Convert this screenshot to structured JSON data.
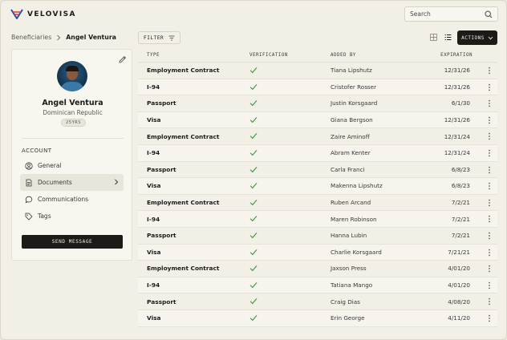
{
  "app": {
    "brand": "VELOVISA"
  },
  "search": {
    "placeholder": "Search"
  },
  "breadcrumb": {
    "root": "Beneficiaries",
    "current": "Angel Ventura"
  },
  "profile": {
    "name": "Angel Ventura",
    "country": "Dominican Republic",
    "age": "25YRS",
    "section_label": "ACCOUNT",
    "nav": [
      {
        "label": "General",
        "icon": "user-circle-icon"
      },
      {
        "label": "Documents",
        "icon": "document-icon",
        "active": true
      },
      {
        "label": "Communications",
        "icon": "chat-bubble-icon"
      },
      {
        "label": "Tags",
        "icon": "tag-icon"
      }
    ],
    "send_label": "SEND MESSAGE"
  },
  "toolbar": {
    "filter_label": "FILTER",
    "actions_label": "ACTIONS"
  },
  "table": {
    "columns": [
      "TYPE",
      "VERIFICATION",
      "ADDED BY",
      "EXPIRATION"
    ],
    "rows": [
      {
        "type": "Employment Contract",
        "verified": true,
        "added_by": "Tiana Lipshutz",
        "expiration": "12/31/26"
      },
      {
        "type": "I-94",
        "verified": true,
        "added_by": "Cristofer Rosser",
        "expiration": "12/31/26"
      },
      {
        "type": "Passport",
        "verified": true,
        "added_by": "Justin Korsgaard",
        "expiration": "6/1/30"
      },
      {
        "type": "Visa",
        "verified": true,
        "added_by": "Giana Bergson",
        "expiration": "12/31/26"
      },
      {
        "type": "Employment Contract",
        "verified": true,
        "added_by": "Zaire Aminoff",
        "expiration": "12/31/24"
      },
      {
        "type": "I-94",
        "verified": true,
        "added_by": "Abram Kenter",
        "expiration": "12/31/24"
      },
      {
        "type": "Passport",
        "verified": true,
        "added_by": "Carla Franci",
        "expiration": "6/8/23"
      },
      {
        "type": "Visa",
        "verified": true,
        "added_by": "Makenna Lipshutz",
        "expiration": "6/8/23"
      },
      {
        "type": "Employment Contract",
        "verified": true,
        "added_by": "Ruben Arcand",
        "expiration": "7/2/21"
      },
      {
        "type": "I-94",
        "verified": true,
        "added_by": "Maren Robinson",
        "expiration": "7/2/21"
      },
      {
        "type": "Passport",
        "verified": true,
        "added_by": "Hanna Lubin",
        "expiration": "7/2/21"
      },
      {
        "type": "Visa",
        "verified": true,
        "added_by": "Charlie Korsgaard",
        "expiration": "7/21/21"
      },
      {
        "type": "Employment Contract",
        "verified": true,
        "added_by": "Jaxson Press",
        "expiration": "4/01/20"
      },
      {
        "type": "I-94",
        "verified": true,
        "added_by": "Tatiana Mango",
        "expiration": "4/01/20"
      },
      {
        "type": "Passport",
        "verified": true,
        "added_by": "Craig Dias",
        "expiration": "4/08/20"
      },
      {
        "type": "Visa",
        "verified": true,
        "added_by": "Erin George",
        "expiration": "4/11/20"
      }
    ]
  },
  "colors": {
    "accent": "#1c1b18",
    "check": "#3a9a44",
    "brand_red": "#d93a3a",
    "brand_blue": "#2a4fa3"
  }
}
